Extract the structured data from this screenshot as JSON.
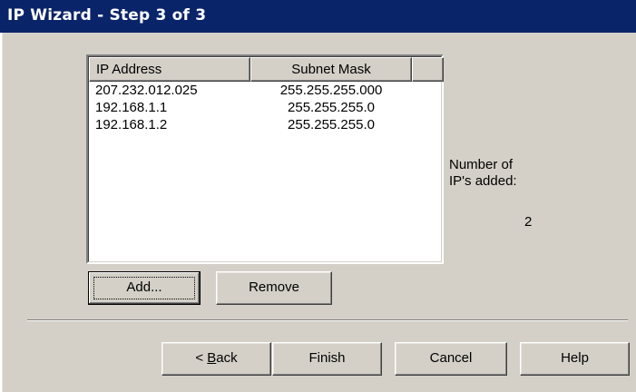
{
  "window": {
    "title": "IP Wizard - Step 3 of 3"
  },
  "list": {
    "columns": [
      "IP Address",
      "Subnet Mask",
      ""
    ],
    "rows": [
      {
        "ip": "207.232.012.025",
        "mask": "255.255.255.000"
      },
      {
        "ip": "192.168.1.1",
        "mask": "255.255.255.0"
      },
      {
        "ip": "192.168.1.2",
        "mask": "255.255.255.0"
      }
    ]
  },
  "count": {
    "label_line1": "Number of",
    "label_line2": "IP's added:",
    "value": "2"
  },
  "buttons": {
    "add": "Add...",
    "remove": "Remove",
    "back_prefix": "< ",
    "back_accel": "B",
    "back_rest": "ack",
    "finish": "Finish",
    "cancel": "Cancel",
    "help": "Help"
  }
}
